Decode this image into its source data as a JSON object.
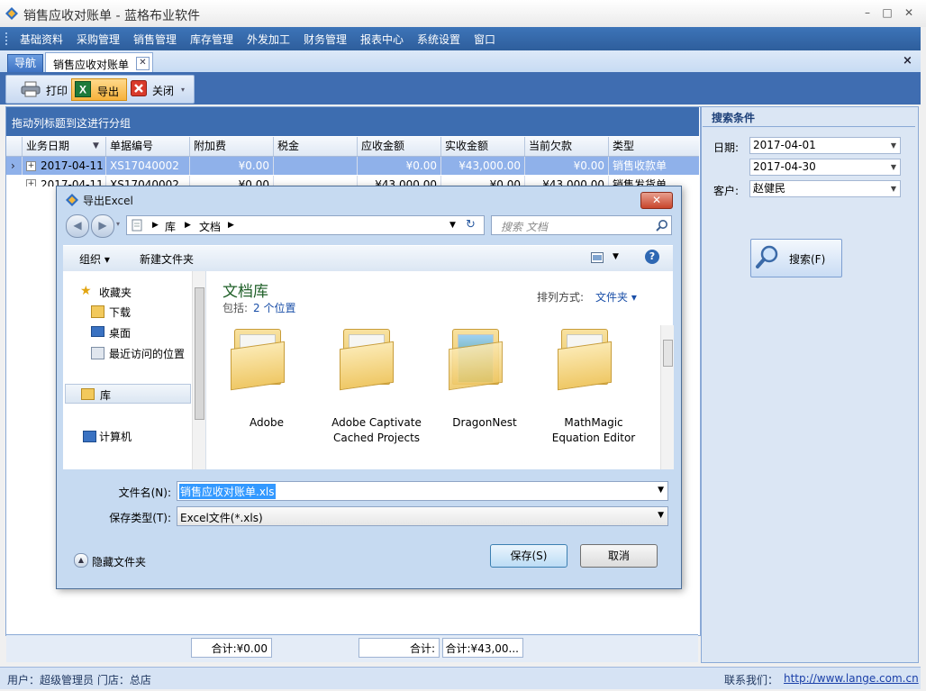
{
  "window": {
    "title": "销售应收对账单 - 蓝格布业软件",
    "minimize": "–",
    "maximize": "□",
    "close": "✕"
  },
  "menu": [
    "基础资料",
    "采购管理",
    "销售管理",
    "库存管理",
    "外发加工",
    "财务管理",
    "报表中心",
    "系统设置",
    "窗口"
  ],
  "tabs": {
    "nav_label": "导航",
    "doc_label": "销售应收对账单",
    "close_glyph": "✕",
    "close_all_glyph": "×"
  },
  "toolbar": {
    "print": "打印",
    "export": "导出",
    "close": "关闭"
  },
  "grid": {
    "group_hint": "拖动列标题到这进行分组",
    "columns": [
      "业务日期",
      "单据编号",
      "附加费",
      "税金",
      "应收金额",
      "实收金额",
      "当前欠款",
      "类型"
    ],
    "rows": [
      [
        "2017-04-11",
        "XS17040002",
        "¥0.00",
        "",
        "¥0.00",
        "¥43,000.00",
        "¥0.00",
        "销售收款单"
      ],
      [
        "2017-04-11",
        "XS17040002",
        "¥0.00",
        "",
        "¥43,000.00",
        "¥0.00",
        "¥43,000.00",
        "销售发货单"
      ]
    ],
    "sum_addfee": "合计:¥0.00",
    "sum_receivable": "合计:",
    "sum_received": "合计:¥43,00..."
  },
  "search": {
    "title": "搜索条件",
    "date_label": "日期:",
    "date_from": "2017-04-01",
    "date_to": "2017-04-30",
    "customer_label": "客户:",
    "customer": "赵健民",
    "button": "搜索(F)"
  },
  "status": {
    "user": "用户：超级管理员  门店：总店",
    "contact_label": "联系我们：",
    "url": "http://www.lange.com.cn"
  },
  "dialog": {
    "title": "导出Excel",
    "close_glyph": "✕",
    "address": [
      "库",
      "文档"
    ],
    "search_placeholder": "搜索 文档",
    "organize": "组织 ▾",
    "new_folder": "新建文件夹",
    "nav_favorites": "收藏夹",
    "nav_downloads": "下载",
    "nav_desktop": "桌面",
    "nav_recent": "最近访问的位置",
    "nav_libraries": "库",
    "nav_computer": "计算机",
    "library_title": "文档库",
    "library_includes": "包括:",
    "library_locations": "2 个位置",
    "sort_label": "排列方式:",
    "sort_value": "文件夹 ▾",
    "folders": [
      {
        "name": "Adobe"
      },
      {
        "name": "Adobe Captivate Cached Projects"
      },
      {
        "name": "DragonNest"
      },
      {
        "name": "MathMagic Equation Editor"
      }
    ],
    "filename_label": "文件名(N):",
    "filename": "销售应收对账单.xls",
    "filetype_label": "保存类型(T):",
    "filetype": "Excel文件(*.xls)",
    "hide_folders": "隐藏文件夹",
    "save": "保存(S)",
    "cancel": "取消"
  }
}
